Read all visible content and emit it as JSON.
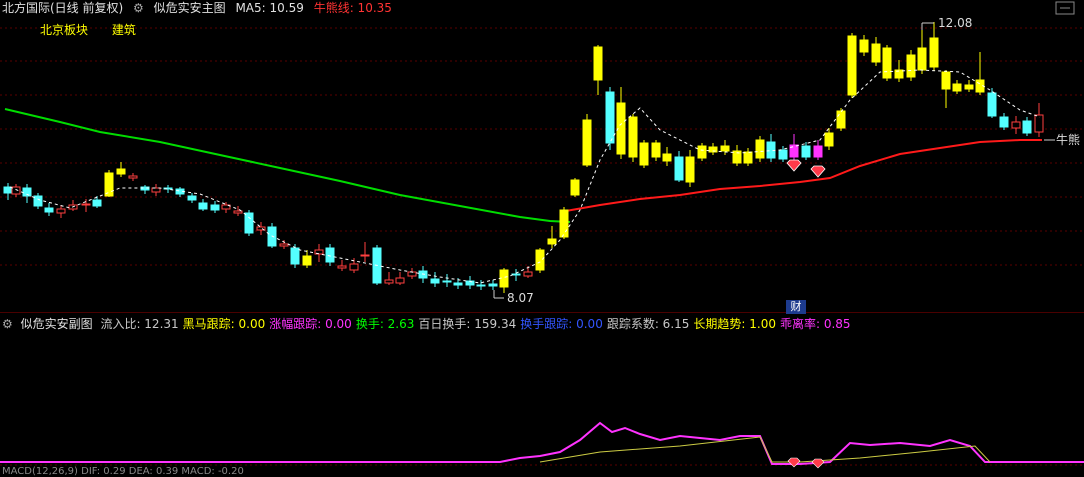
{
  "main_header": {
    "title": "北方国际(日线 前复权)",
    "indicator_name": "似危实安主图",
    "ma5_label": "MA5: 10.59",
    "bull_label": "牛熊线: 10.35"
  },
  "tags": [
    "北京板块",
    "建筑"
  ],
  "annotations": {
    "high": "12.08",
    "low": "8.07",
    "right_label": "牛熊",
    "cai": "财"
  },
  "sub_header": {
    "indicator_name": "似危实安副图",
    "items": [
      {
        "label": "流入比: 12.31",
        "color": "#c8c8c8"
      },
      {
        "label": "黑马跟踪: 0.00",
        "color": "#ffff00"
      },
      {
        "label": "涨幅跟踪: 0.00",
        "color": "#ff33ff"
      },
      {
        "label": "换手: 2.63",
        "color": "#00ff00"
      },
      {
        "label": "百日换手: 159.34",
        "color": "#c8c8c8"
      },
      {
        "label": "换手跟踪: 0.00",
        "color": "#3355ff"
      },
      {
        "label": "跟踪系数: 6.15",
        "color": "#c8c8c8"
      },
      {
        "label": "长期趋势: 1.00",
        "color": "#ffff00"
      },
      {
        "label": "乖离率: 0.85",
        "color": "#ff33ff"
      }
    ]
  },
  "bottom_row": "MACD(12,26,9) DIF: 0.29 DEA: 0.39 MACD: -0.20",
  "colors": {
    "up_yellow": "#ffff00",
    "up_red": "#ff4040",
    "down_cyan": "#54ffff",
    "pink": "#ff33ff",
    "ma_green": "#00dd00",
    "bull_red": "#ff1a1a",
    "white_dash": "#ffffff"
  }
}
